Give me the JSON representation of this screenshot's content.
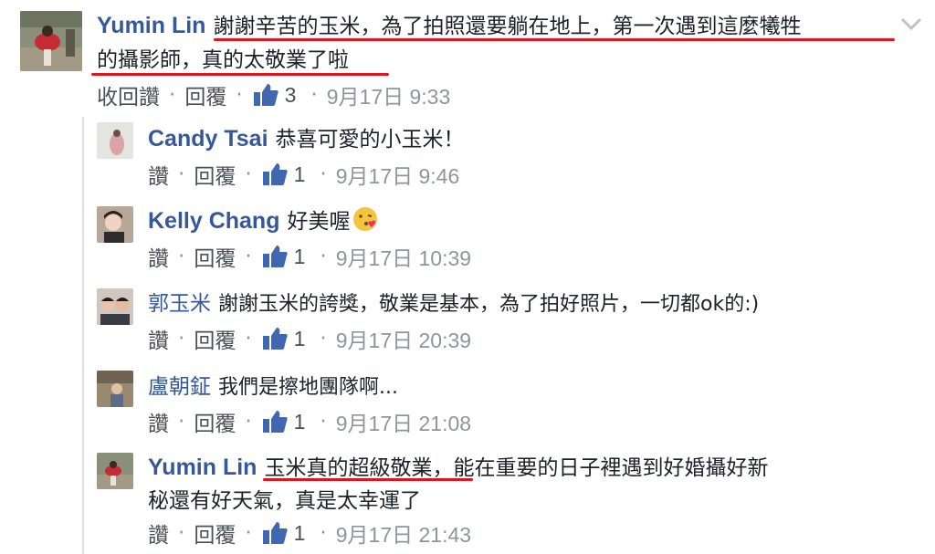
{
  "colors": {
    "name": "#365899",
    "meta": "#90949c",
    "underline": "#e0141e",
    "like": "#4267b2"
  },
  "main_comment": {
    "author": "Yumin Lin",
    "text_line1": "謝謝辛苦的玉米，為了拍照還要躺在地上，第一次遇到這麼犧牲",
    "text_line2": "的攝影師，真的太敬業了啦",
    "actions": {
      "unlike": "收回讚",
      "sep": "·",
      "reply": "回覆"
    },
    "likes": "3",
    "date": "9月17日 9:33",
    "icon": "thumbs-up-icon"
  },
  "replies": [
    {
      "author": "Candy Tsai",
      "text": "恭喜可愛的小玉米！",
      "like": "讚",
      "reply": "回覆",
      "likes": "1",
      "date": "9月17日 9:46"
    },
    {
      "author": "Kelly Chang",
      "text": "好美喔",
      "emoji": "kissing-face-icon",
      "like": "讚",
      "reply": "回覆",
      "likes": "1",
      "date": "9月17日 10:39"
    },
    {
      "author": "郭玉米",
      "text": "謝謝玉米的誇獎，敬業是基本，為了拍好照片，一切都ok的:)",
      "like": "讚",
      "reply": "回覆",
      "likes": "1",
      "date": "9月17日 20:39"
    },
    {
      "author": "盧朝鉦",
      "text": "我們是擦地團隊啊...",
      "like": "讚",
      "reply": "回覆",
      "likes": "1",
      "date": "9月17日 21:08"
    },
    {
      "author": "Yumin Lin",
      "text_line1": "玉米真的超級敬業，能在重要的日子裡遇到好婚攝好新",
      "text_line2": "秘還有好天氣，真是太幸運了",
      "like": "讚",
      "reply": "回覆",
      "likes": "1",
      "date": "9月17日 21:43"
    }
  ]
}
